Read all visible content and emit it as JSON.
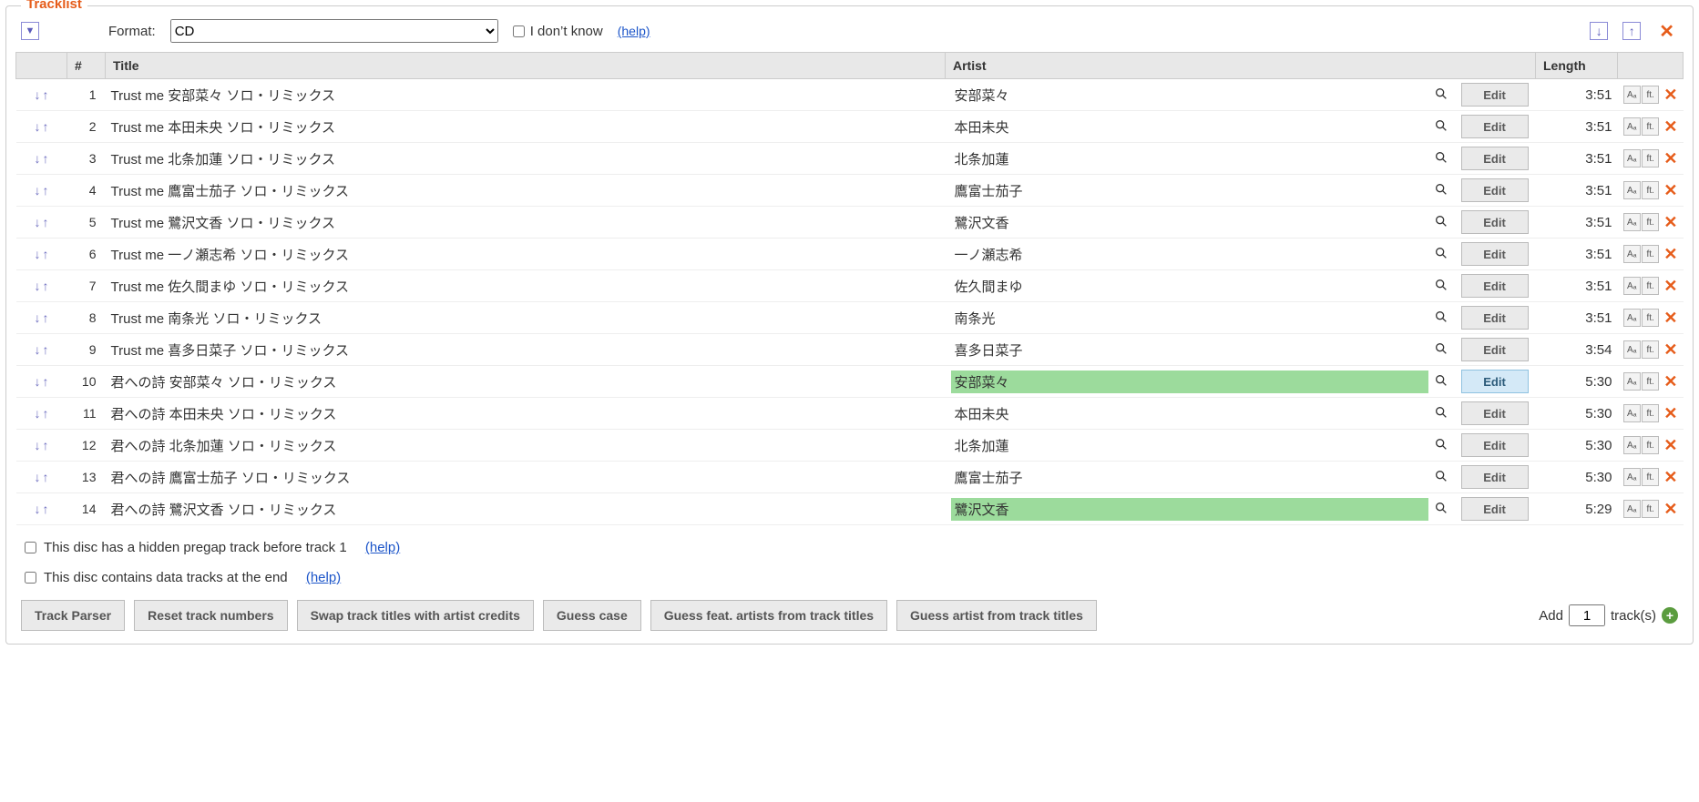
{
  "legend": "Tracklist",
  "format_label": "Format:",
  "format_value": "CD",
  "idk_label": "I don’t know",
  "help_text": "(help)",
  "header_cols": {
    "num": "#",
    "title": "Title",
    "artist": "Artist",
    "length": "Length"
  },
  "tracks": [
    {
      "n": "1",
      "title": "Trust me 安部菜々 ソロ・リミックス",
      "artist": "安部菜々",
      "len": "3:51",
      "hl": false,
      "edit_active": false
    },
    {
      "n": "2",
      "title": "Trust me 本田未央 ソロ・リミックス",
      "artist": "本田未央",
      "len": "3:51",
      "hl": false,
      "edit_active": false
    },
    {
      "n": "3",
      "title": "Trust me 北条加蓮 ソロ・リミックス",
      "artist": "北条加蓮",
      "len": "3:51",
      "hl": false,
      "edit_active": false
    },
    {
      "n": "4",
      "title": "Trust me 鷹富士茄子 ソロ・リミックス",
      "artist": "鷹富士茄子",
      "len": "3:51",
      "hl": false,
      "edit_active": false
    },
    {
      "n": "5",
      "title": "Trust me 鷺沢文香 ソロ・リミックス",
      "artist": "鷺沢文香",
      "len": "3:51",
      "hl": false,
      "edit_active": false
    },
    {
      "n": "6",
      "title": "Trust me 一ノ瀬志希 ソロ・リミックス",
      "artist": "一ノ瀬志希",
      "len": "3:51",
      "hl": false,
      "edit_active": false
    },
    {
      "n": "7",
      "title": "Trust me 佐久間まゆ ソロ・リミックス",
      "artist": "佐久間まゆ",
      "len": "3:51",
      "hl": false,
      "edit_active": false
    },
    {
      "n": "8",
      "title": "Trust me 南条光 ソロ・リミックス",
      "artist": "南条光",
      "len": "3:51",
      "hl": false,
      "edit_active": false
    },
    {
      "n": "9",
      "title": "Trust me 喜多日菜子 ソロ・リミックス",
      "artist": "喜多日菜子",
      "len": "3:54",
      "hl": false,
      "edit_active": false
    },
    {
      "n": "10",
      "title": "君への詩 安部菜々 ソロ・リミックス",
      "artist": "安部菜々",
      "len": "5:30",
      "hl": true,
      "edit_active": true
    },
    {
      "n": "11",
      "title": "君への詩 本田未央 ソロ・リミックス",
      "artist": "本田未央",
      "len": "5:30",
      "hl": false,
      "edit_active": false
    },
    {
      "n": "12",
      "title": "君への詩 北条加蓮 ソロ・リミックス",
      "artist": "北条加蓮",
      "len": "5:30",
      "hl": false,
      "edit_active": false
    },
    {
      "n": "13",
      "title": "君への詩 鷹富士茄子 ソロ・リミックス",
      "artist": "鷹富士茄子",
      "len": "5:30",
      "hl": false,
      "edit_active": false
    },
    {
      "n": "14",
      "title": "君への詩 鷺沢文香 ソロ・リミックス",
      "artist": "鷺沢文香",
      "len": "5:29",
      "hl": true,
      "edit_active": false
    }
  ],
  "edit_label": "Edit",
  "mini_aa": "Aₐ",
  "mini_ft": "ft.",
  "options": {
    "pregap": "This disc has a hidden pregap track before track 1",
    "data": "This disc contains data tracks at the end"
  },
  "buttons": {
    "parser": "Track Parser",
    "reset": "Reset track numbers",
    "swap": "Swap track titles with artist credits",
    "guess": "Guess case",
    "feat": "Guess feat. artists from track titles",
    "gartist": "Guess artist from track titles"
  },
  "add": {
    "prefix": "Add",
    "value": "1",
    "suffix": "track(s)"
  }
}
